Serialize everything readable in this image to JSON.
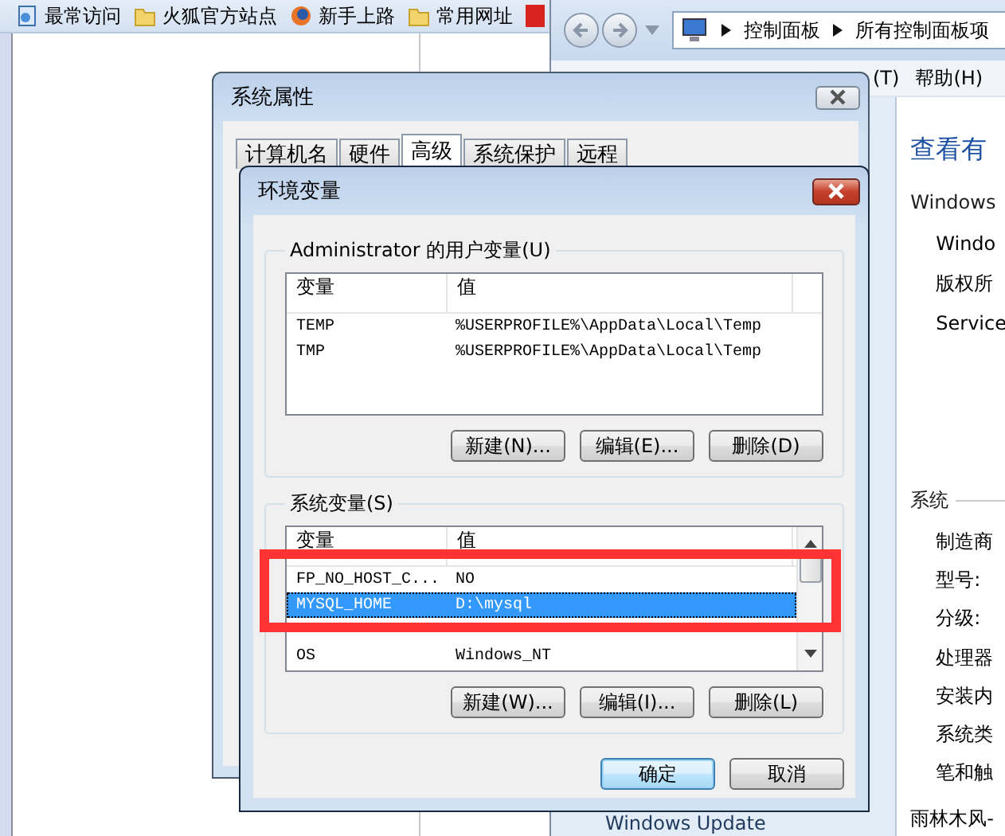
{
  "browser": {
    "bookmarks": [
      {
        "kind": "page",
        "label": "最常访问"
      },
      {
        "kind": "folder",
        "label": "火狐官方站点"
      },
      {
        "kind": "globe",
        "label": "新手上路"
      },
      {
        "kind": "folder",
        "label": "常用网址"
      }
    ]
  },
  "control_panel": {
    "breadcrumb": [
      "控制面板",
      "所有控制面板项"
    ],
    "menu": [
      "(T)",
      "帮助(H)"
    ],
    "heading": "查看有",
    "sections": [
      {
        "title": "Windows",
        "items": [
          "Windo",
          "版权所",
          "Service"
        ]
      },
      {
        "title": "系统",
        "items": [
          "制造商",
          "型号:",
          "分级:",
          "处理器",
          "安装内",
          "系统类",
          "笔和触"
        ]
      }
    ],
    "footer": "雨林木风-",
    "left_link": "Windows Update"
  },
  "system_properties": {
    "title": "系统属性",
    "tabs": [
      {
        "label": "计算机名",
        "selected": false
      },
      {
        "label": "硬件",
        "selected": false
      },
      {
        "label": "高级",
        "selected": true
      },
      {
        "label": "系统保护",
        "selected": false
      },
      {
        "label": "远程",
        "selected": false
      }
    ]
  },
  "env": {
    "title": "环境变量",
    "user_vars": {
      "label": "Administrator 的用户变量(U)",
      "columns": [
        "变量",
        "值"
      ],
      "rows": [
        {
          "name": "TEMP",
          "value": "%USERPROFILE%\\AppData\\Local\\Temp",
          "selected": false
        },
        {
          "name": "TMP",
          "value": "%USERPROFILE%\\AppData\\Local\\Temp",
          "selected": false
        }
      ],
      "buttons": [
        "新建(N)...",
        "编辑(E)...",
        "删除(D)"
      ]
    },
    "system_vars": {
      "label": "系统变量(S)",
      "columns": [
        "变量",
        "值"
      ],
      "rows": [
        {
          "name": "FP_NO_HOST_C...",
          "value": "NO",
          "selected": false
        },
        {
          "name": "MYSQL_HOME",
          "value": "D:\\mysql",
          "selected": true
        },
        {
          "name": "",
          "value": "",
          "selected": false
        },
        {
          "name": "OS",
          "value": "Windows_NT",
          "selected": false
        }
      ],
      "buttons": [
        "新建(W)...",
        "编辑(I)...",
        "删除(L)"
      ]
    },
    "buttons": [
      {
        "label": "确定",
        "default": true
      },
      {
        "label": "取消",
        "default": false
      }
    ]
  }
}
